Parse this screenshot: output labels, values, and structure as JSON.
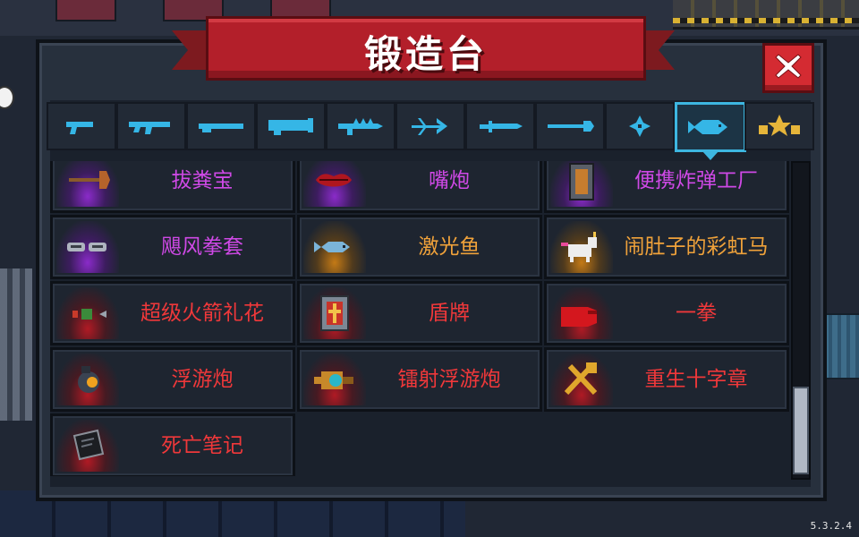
{
  "title": "锻造台",
  "version": "5.3.2.4",
  "accent": "#3db6e0",
  "tabs": [
    {
      "icon": "pistol-icon",
      "active": false
    },
    {
      "icon": "rifle-icon",
      "active": false
    },
    {
      "icon": "shotgun-icon",
      "active": false
    },
    {
      "icon": "launcher-icon",
      "active": false
    },
    {
      "icon": "spiked-rifle-icon",
      "active": false
    },
    {
      "icon": "bow-icon",
      "active": false
    },
    {
      "icon": "sword-icon",
      "active": false
    },
    {
      "icon": "spear-icon",
      "active": false
    },
    {
      "icon": "shuriken-icon",
      "active": false
    },
    {
      "icon": "fish-icon",
      "active": true
    },
    {
      "icon": "star-items-icon",
      "active": false
    }
  ],
  "items": [
    {
      "name": "拔粪宝",
      "rarity": "purple",
      "icon": "plunger-icon"
    },
    {
      "name": "嘴炮",
      "rarity": "purple",
      "icon": "lips-icon"
    },
    {
      "name": "便携炸弹工厂",
      "rarity": "purple",
      "icon": "bomb-factory-icon"
    },
    {
      "name": "飓风拳套",
      "rarity": "purple",
      "icon": "gauntlet-icon"
    },
    {
      "name": "激光鱼",
      "rarity": "orange",
      "icon": "laser-fish-icon"
    },
    {
      "name": "闹肚子的彩虹马",
      "rarity": "orange",
      "icon": "unicorn-icon"
    },
    {
      "name": "超级火箭礼花",
      "rarity": "red",
      "icon": "firework-icon"
    },
    {
      "name": "盾牌",
      "rarity": "red",
      "icon": "shield-icon"
    },
    {
      "name": "一拳",
      "rarity": "red",
      "icon": "red-glove-icon"
    },
    {
      "name": "浮游炮",
      "rarity": "red",
      "icon": "drone-icon"
    },
    {
      "name": "镭射浮游炮",
      "rarity": "red",
      "icon": "laser-drone-icon"
    },
    {
      "name": "重生十字章",
      "rarity": "red",
      "icon": "cross-medal-icon"
    },
    {
      "name": "死亡笔记",
      "rarity": "red",
      "icon": "death-note-icon"
    }
  ]
}
